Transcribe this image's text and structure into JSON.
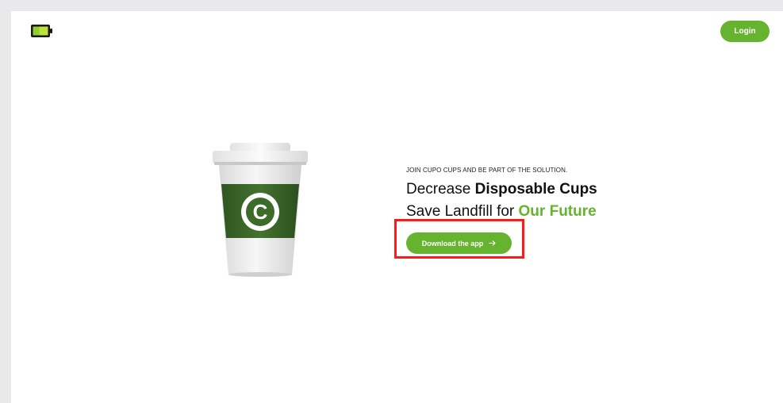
{
  "header": {
    "logo_icon": "battery-icon",
    "login_label": "Login"
  },
  "hero": {
    "kicker": "JOIN CUPO CUPS AND BE PART OF THE SOLUTION.",
    "line1_plain": "Decrease",
    "line1_bold": "Disposable Cups",
    "line2_plain": "Save Landfill for",
    "line2_highlight": "Our Future",
    "cta_label": "Download the app",
    "cta_icon": "arrow-right-icon",
    "cup_logo_letter": "C"
  },
  "colors": {
    "brand_green": "#65b32e",
    "cup_green": "#3d6b2a",
    "highlight_red": "#ff1a1a"
  }
}
